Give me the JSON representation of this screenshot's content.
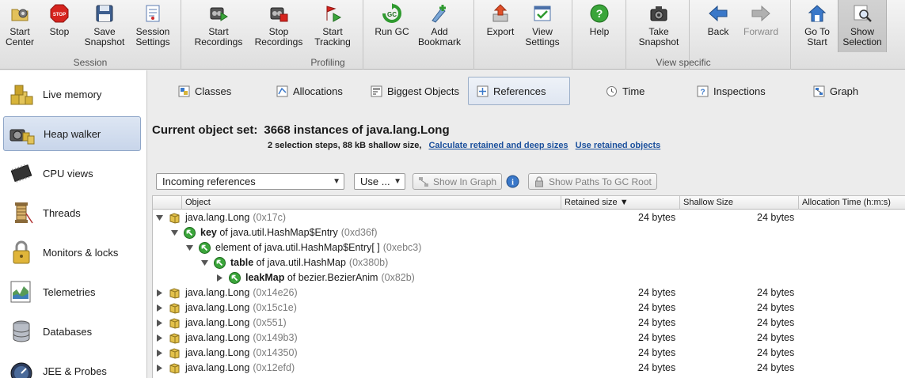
{
  "toolbar": {
    "buttons": {
      "start_center": "Start\nCenter",
      "stop": "Stop",
      "save_snapshot": "Save\nSnapshot",
      "session_settings": "Session\nSettings",
      "start_recordings": "Start\nRecordings",
      "stop_recordings": "Stop\nRecordings",
      "start_tracking": "Start\nTracking",
      "run_gc": "Run GC",
      "add_bookmark": "Add\nBookmark",
      "export": "Export",
      "view_settings": "View\nSettings",
      "help": "Help",
      "take_snapshot": "Take\nSnapshot",
      "back": "Back",
      "forward": "Forward",
      "go_to_start": "Go To\nStart",
      "show_selection": "Show\nSelection"
    },
    "groups": {
      "session": "Session",
      "profiling": "Profiling",
      "view_specific": "View specific"
    }
  },
  "sidebar": {
    "items": [
      {
        "label": "Live memory",
        "icon": "live-memory-icon"
      },
      {
        "label": "Heap walker",
        "icon": "heap-walker-icon",
        "active": true
      },
      {
        "label": "CPU views",
        "icon": "cpu-views-icon"
      },
      {
        "label": "Threads",
        "icon": "threads-icon"
      },
      {
        "label": "Monitors & locks",
        "icon": "monitors-locks-icon"
      },
      {
        "label": "Telemetries",
        "icon": "telemetries-icon"
      },
      {
        "label": "Databases",
        "icon": "databases-icon"
      },
      {
        "label": "JEE & Probes",
        "icon": "jee-probes-icon"
      }
    ]
  },
  "tabs": [
    {
      "label": "Classes"
    },
    {
      "label": "Allocations"
    },
    {
      "label": "Biggest Objects"
    },
    {
      "label": "References",
      "active": true
    },
    {
      "label": "Time"
    },
    {
      "label": "Inspections"
    },
    {
      "label": "Graph"
    }
  ],
  "object_set": {
    "title": "Current object set:",
    "value": "3668 instances of java.lang.Long",
    "subtitle": "2 selection steps, 88 kB shallow size,",
    "link_calculate": "Calculate retained and deep sizes",
    "link_use_retained": "Use retained objects"
  },
  "controls": {
    "reference_mode": "Incoming references",
    "use_dropdown": "Use ...",
    "show_in_graph": "Show In Graph",
    "show_paths": "Show Paths To GC Root"
  },
  "table": {
    "columns": [
      "Object",
      "Retained size",
      "Shallow Size",
      "Allocation Time (h:m:s)"
    ],
    "sort_indicator": "▼",
    "rows": [
      {
        "prefix": "java.lang.Long",
        "strong": "",
        "suffix": "",
        "addr": "(0x17c)",
        "retained": "24 bytes",
        "shallow": "24 bytes"
      },
      {
        "prefix": "",
        "strong": "key",
        "suffix": " of java.util.HashMap$Entry",
        "addr": "(0xd36f)",
        "retained": "",
        "shallow": ""
      },
      {
        "prefix": "element of java.util.HashMap$Entry[ ]",
        "strong": "",
        "suffix": "",
        "addr": "(0xebc3)",
        "retained": "",
        "shallow": ""
      },
      {
        "prefix": "",
        "strong": "table",
        "suffix": " of java.util.HashMap",
        "addr": "(0x380b)",
        "retained": "",
        "shallow": ""
      },
      {
        "prefix": "",
        "strong": "leakMap",
        "suffix": " of bezier.BezierAnim",
        "addr": "(0x82b)",
        "retained": "",
        "shallow": ""
      },
      {
        "prefix": "java.lang.Long",
        "strong": "",
        "suffix": "",
        "addr": "(0x14e26)",
        "retained": "24 bytes",
        "shallow": "24 bytes"
      },
      {
        "prefix": "java.lang.Long",
        "strong": "",
        "suffix": "",
        "addr": "(0x15c1e)",
        "retained": "24 bytes",
        "shallow": "24 bytes"
      },
      {
        "prefix": "java.lang.Long",
        "strong": "",
        "suffix": "",
        "addr": "(0x551)",
        "retained": "24 bytes",
        "shallow": "24 bytes"
      },
      {
        "prefix": "java.lang.Long",
        "strong": "",
        "suffix": "",
        "addr": "(0x149b3)",
        "retained": "24 bytes",
        "shallow": "24 bytes"
      },
      {
        "prefix": "java.lang.Long",
        "strong": "",
        "suffix": "",
        "addr": "(0x14350)",
        "retained": "24 bytes",
        "shallow": "24 bytes"
      },
      {
        "prefix": "java.lang.Long",
        "strong": "",
        "suffix": "",
        "addr": "(0x12efd)",
        "retained": "24 bytes",
        "shallow": "24 bytes"
      }
    ]
  }
}
